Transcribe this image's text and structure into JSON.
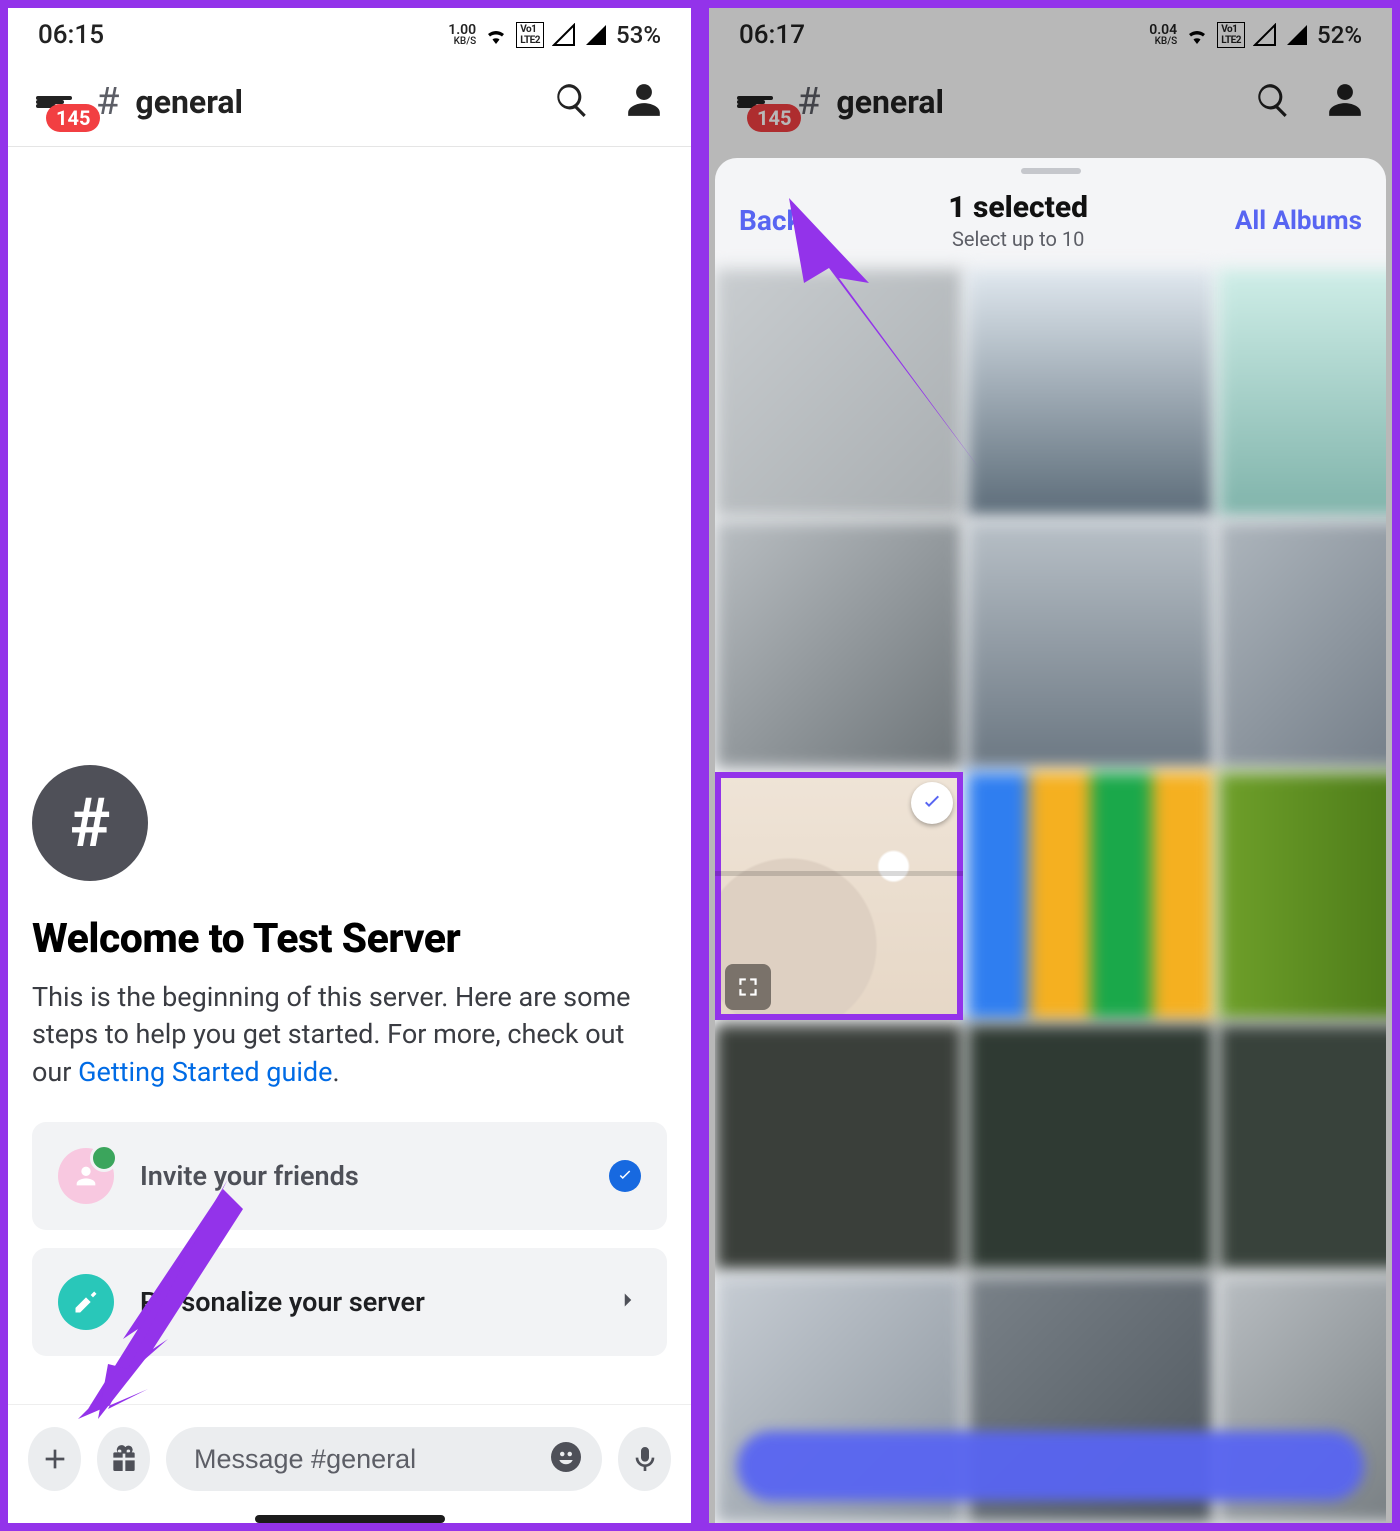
{
  "left": {
    "status": {
      "time": "06:15",
      "kbs": "1.00",
      "kbs_unit": "KB/S",
      "battery": "53%"
    },
    "header": {
      "badge": "145",
      "channel": "general"
    },
    "welcome": {
      "title": "Welcome to Test Server",
      "desc_pre": "This is the beginning of this server. Here are some steps to help you get started. For more, check out our ",
      "link": "Getting Started guide",
      "desc_post": "."
    },
    "steps": {
      "invite": "Invite your friends",
      "personalize": "Personalize your server"
    },
    "composer": {
      "placeholder": "Message #general"
    }
  },
  "right": {
    "status": {
      "time": "06:17",
      "kbs": "0.04",
      "kbs_unit": "KB/S",
      "battery": "52%"
    },
    "header": {
      "badge": "145",
      "channel": "general"
    },
    "picker": {
      "back": "Back",
      "title": "1 selected",
      "subtitle": "Select up to 10",
      "albums": "All Albums"
    }
  }
}
